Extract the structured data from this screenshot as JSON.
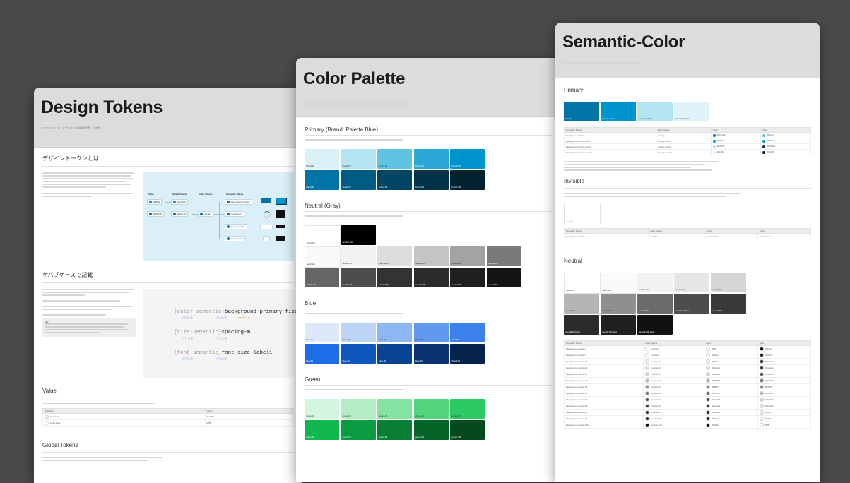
{
  "design_tokens": {
    "title": "Design Tokens",
    "desc": "ベースファイルでは、トークン名と値の関係を定義しています。",
    "section1": {
      "title": "デザイントークンとは"
    },
    "diagram": {
      "headers": [
        "Value",
        "Global Tokens",
        "Alias Tokens",
        "Semantic Tokens"
      ],
      "nodes": [
        "#f8f9fa",
        "blue-500",
        "primary",
        "background-primary"
      ]
    },
    "section2": {
      "title": "ケバブケースで記載",
      "note_label": "Tips",
      "examples": [
        {
          "cat": "color-semantic",
          "name": "background-primary-fixed"
        },
        {
          "cat": "size-semantic",
          "name": "spacing-m"
        },
        {
          "cat": "font-semantic",
          "name": "font-size-label1"
        }
      ]
    },
    "value_section": {
      "title": "Value",
      "table_headers": [
        "Variables",
        "Value"
      ],
      "rows": [
        [
          "brand-50",
          "#e3f2fd"
        ],
        [
          "white-base",
          "#ffffff"
        ]
      ]
    },
    "global_section": {
      "title": "Global Tokens"
    }
  },
  "color_palette": {
    "title": "Color Palette",
    "sections": [
      {
        "title": "Primary (Brand: Palette Blue)",
        "rows": [
          [
            [
              "brand-10",
              "#d9f1f7"
            ],
            [
              "brand-20",
              "#b3e5f2"
            ],
            [
              "brand-30",
              "#5fc4e3"
            ],
            [
              "brand-40",
              "#2ba7d8"
            ],
            [
              "brand-50",
              "#0094cf"
            ]
          ],
          [
            [
              "brand-60",
              "#0074a6"
            ],
            [
              "brand-70",
              "#005b84"
            ],
            [
              "brand-80",
              "#004563"
            ],
            [
              "brand-90",
              "#00334a"
            ],
            [
              "brand-100",
              "#00222f"
            ]
          ]
        ]
      },
      {
        "title": "Neutral (Gray)",
        "rows": [
          [
            [
              "neutral-0",
              "#ffffff"
            ],
            [
              "neutral-100",
              "#000000"
            ]
          ],
          [
            [
              "neutral-5",
              "#fafafa"
            ],
            [
              "neutral-10",
              "#f2f2f2"
            ],
            [
              "neutral-20",
              "#dddddd"
            ],
            [
              "neutral-30",
              "#c4c4c4"
            ],
            [
              "neutral-40",
              "#a3a3a3"
            ],
            [
              "neutral-50",
              "#7a7a7a"
            ]
          ],
          [
            [
              "neutral-60",
              "#666666"
            ],
            [
              "neutral-70",
              "#4d4d4d"
            ],
            [
              "neutral-80",
              "#333333"
            ],
            [
              "neutral-85",
              "#2b2b2b"
            ],
            [
              "neutral-90",
              "#1f1f1f"
            ],
            [
              "neutral-95",
              "#141414"
            ]
          ]
        ]
      },
      {
        "title": "Blue",
        "rows": [
          [
            [
              "blue-10",
              "#dde9fb"
            ],
            [
              "blue-20",
              "#bcd5f7"
            ],
            [
              "blue-30",
              "#8db7f2"
            ],
            [
              "blue-40",
              "#5f98ee"
            ],
            [
              "blue-50",
              "#3d82ec"
            ]
          ],
          [
            [
              "blue-60",
              "#1d6ee6"
            ],
            [
              "blue-70",
              "#0f56bd"
            ],
            [
              "blue-80",
              "#0b4394"
            ],
            [
              "blue-90",
              "#083370"
            ],
            [
              "blue-100",
              "#05234d"
            ]
          ]
        ]
      },
      {
        "title": "Green",
        "rows": [
          [
            [
              "green-10",
              "#d6f5df"
            ],
            [
              "green-20",
              "#b2edc3"
            ],
            [
              "green-30",
              "#84e2a2"
            ],
            [
              "green-40",
              "#53d57d"
            ],
            [
              "green-50",
              "#2cc964"
            ]
          ],
          [
            [
              "green-60",
              "#12b64f"
            ],
            [
              "green-70",
              "#0a9a40"
            ],
            [
              "green-80",
              "#087f35"
            ],
            [
              "green-90",
              "#066429"
            ],
            [
              "green-100",
              "#044a1e"
            ]
          ]
        ]
      }
    ]
  },
  "semantic_color": {
    "title": "Semantic-Color",
    "primary": {
      "title": "Primary",
      "swatches": [
        [
          "primary",
          "#0074a6"
        ],
        [
          "primary-fixed",
          "#0094cf"
        ],
        [
          "primary-bright",
          "#b3e5f2"
        ],
        [
          "primary-variant",
          "#e1f3fa"
        ]
      ],
      "table_headers": [
        "Semantic Tokens",
        "Alias Tokens",
        "Light",
        "Dark"
      ],
      "rows": [
        [
          "background-primary",
          "primary",
          "#0074a6",
          "#5fc4e3"
        ],
        [
          "background-primary-fixed",
          "primary-fixed",
          "#0094cf",
          "#0094cf"
        ],
        [
          "background-primary-bright",
          "primary-bright",
          "#b3e5f2",
          "#00334a"
        ],
        [
          "background-primary-variant",
          "primary-variant",
          "#e1f3fa",
          "#00222f"
        ]
      ]
    },
    "invisible": {
      "title": "Invisible",
      "swatch_label": "invisible"
    },
    "neutral": {
      "title": "Neutral",
      "swatches": [
        [
          [
            "neutral-0",
            "#ffffff"
          ],
          [
            "neutral-5",
            "#fafafa"
          ],
          [
            "neutral-10",
            "#f2f2f2"
          ],
          [
            "neutral-20",
            "#e6e6e6"
          ],
          [
            "neutral-30",
            "#d6d6d6"
          ]
        ],
        [
          [
            "neutral-40",
            "#b5b5b5"
          ],
          [
            "neutral-50",
            "#8f8f8f"
          ],
          [
            "neutral-60",
            "#6b6b6b"
          ],
          [
            "neutral-70 fixed",
            "#4d4d4d"
          ],
          [
            "neutral-80",
            "#3a3a3a"
          ]
        ],
        [
          [
            "neutral-90 fixed",
            "#2b2b2b"
          ],
          [
            "neutral-95 fixed",
            "#1f1f1f"
          ],
          [
            "neutral-100 fixed",
            "#111111"
          ]
        ]
      ]
    }
  }
}
